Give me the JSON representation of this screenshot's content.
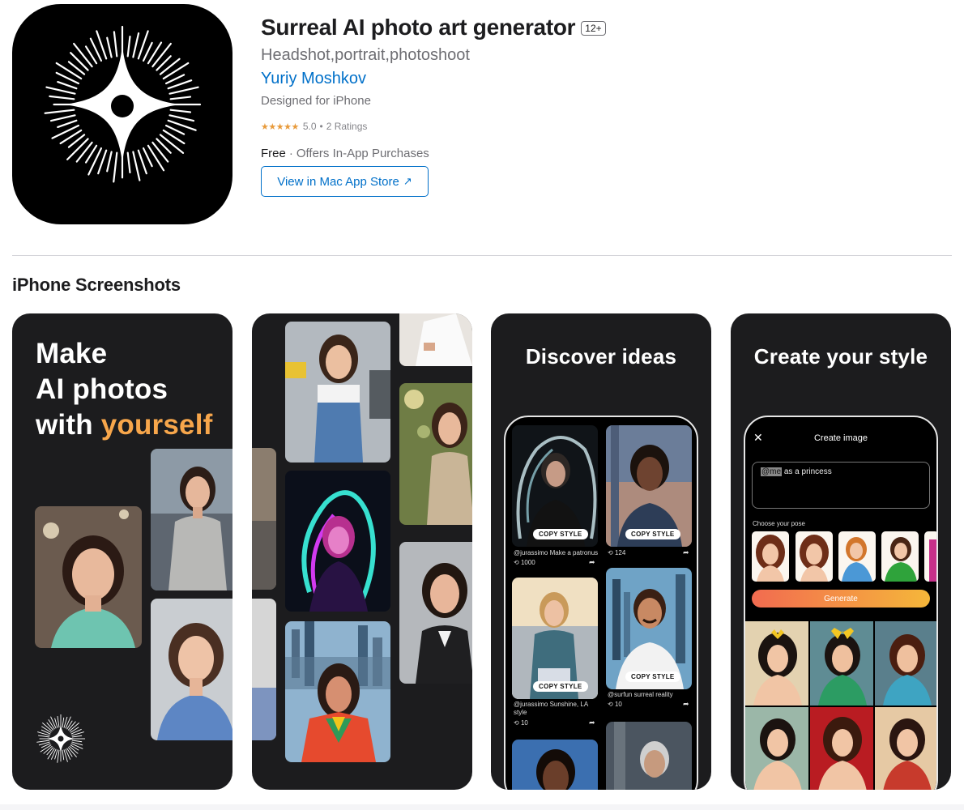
{
  "app": {
    "title": "Surreal AI photo art generator",
    "age_rating": "12+",
    "subtitle": "Headshot,portrait,photoshoot",
    "developer": "Yuriy Moshkov",
    "designed_for": "Designed for iPhone",
    "stars": "★★★★★",
    "rating_value": "5.0",
    "rating_dot": "•",
    "rating_count": "2 Ratings",
    "price": "Free",
    "price_separator": "·",
    "in_app": "Offers In-App Purchases",
    "mac_button_label": "View in Mac App Store",
    "mac_button_icon": "↗",
    "icon_name": "sparkle-star-logo-icon"
  },
  "section": {
    "title": "iPhone Screenshots"
  },
  "screenshots": {
    "first": {
      "line1": "Make",
      "line2": "AI photos",
      "line3_prefix": "with ",
      "line3_accent": "yourself",
      "accent_color": "#f7a64b"
    },
    "third": {
      "heading": "Discover ideas",
      "copy_style": "COPY STYLE",
      "posts": [
        {
          "caption": "@jurassimo Make a patronus",
          "count": "1000"
        },
        {
          "caption": "",
          "count": "124"
        },
        {
          "caption": "@jurassimo Sunshine, LA style",
          "count": "10"
        },
        {
          "caption": "@surfun surreal reality",
          "count": "10"
        }
      ],
      "repost_icon": "⟲",
      "share_icon": "➦"
    },
    "fourth": {
      "heading": "Create your style",
      "screen_title": "Create image",
      "close_icon": "✕",
      "prompt_tag": "@me",
      "prompt_rest": " as a princess",
      "pose_label": "Choose your pose",
      "generate_label": "Generate"
    }
  }
}
